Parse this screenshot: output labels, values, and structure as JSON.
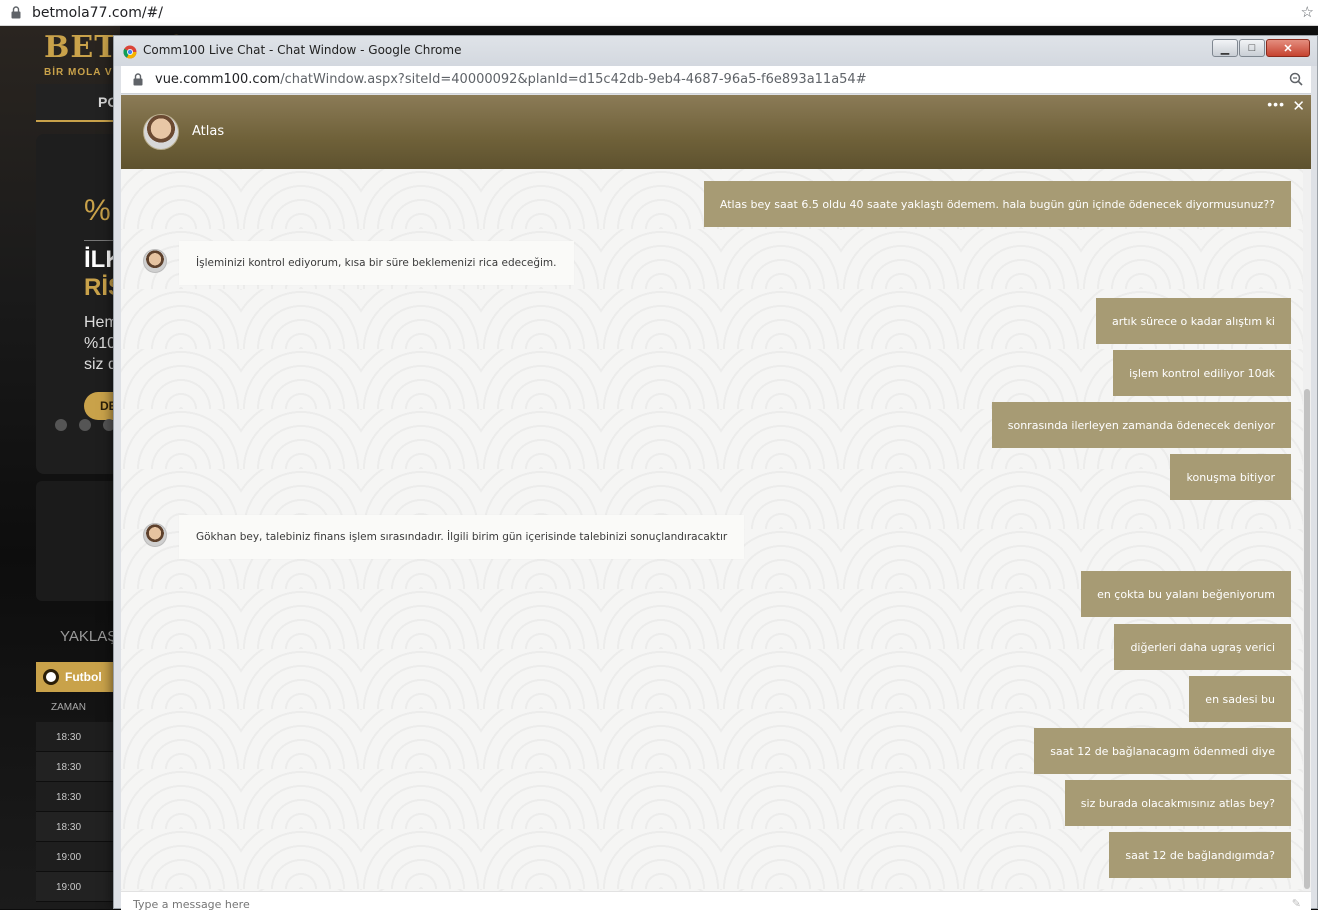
{
  "browser": {
    "url": "betmola77.com/#/"
  },
  "site": {
    "logo_text": "BET MOLA",
    "logo_sub": "BİR MOLA VE",
    "nav_item": "PO",
    "promo": {
      "percent": "%",
      "line1": "İLK",
      "line2": "RİS",
      "text1": "Hem",
      "text2": "%10",
      "text3": "siz d",
      "button": "DE"
    },
    "upcoming": "YAKLAŞ",
    "sport_tab": "Futbol",
    "time_header": "ZAMAN",
    "times": [
      "18:30",
      "18:30",
      "18:30",
      "18:30",
      "19:00",
      "19:00"
    ]
  },
  "popup": {
    "title": "Comm100 Live Chat - Chat Window - Google Chrome",
    "url_host": "vue.comm100.com",
    "url_path": "/chatWindow.aspx?siteId=40000092&planId=d15c42db-9eb4-4687-96a5-f6e893a11a54#",
    "btn_min": "▁",
    "btn_max": "□",
    "btn_close": "✕"
  },
  "chat": {
    "agent_name": "Atlas",
    "more_label": "•••",
    "close_label": "✕",
    "composer_placeholder": "Type a message here",
    "messages": [
      {
        "from": "visitor",
        "text": "Atlas bey saat 6.5 oldu 40 saate yaklaştı ödemem. hala bugün gün içinde ödenecek diyormusunuz??"
      },
      {
        "from": "agent",
        "text": "İşleminizi kontrol ediyorum, kısa bir süre beklemenizi rica edeceğim."
      },
      {
        "from": "visitor",
        "text": "artık sürece o kadar alıştım ki"
      },
      {
        "from": "visitor",
        "text": "işlem kontrol ediliyor 10dk"
      },
      {
        "from": "visitor",
        "text": "sonrasında ilerleyen zamanda ödenecek deniyor"
      },
      {
        "from": "visitor",
        "text": "konuşma bitiyor"
      },
      {
        "from": "agent",
        "text": "Gökhan bey, talebiniz finans işlem sırasındadır. İlgili birim gün içerisinde talebinizi sonuçlandıracaktır"
      },
      {
        "from": "visitor",
        "text": "en çokta bu yalanı beğeniyorum"
      },
      {
        "from": "visitor",
        "text": "diğerleri daha ugraş verici"
      },
      {
        "from": "visitor",
        "text": "en sadesi bu"
      },
      {
        "from": "visitor",
        "text": "saat 12 de bağlanacagım ödenmedi diye"
      },
      {
        "from": "visitor",
        "text": "siz burada olacakmısınız atlas bey?"
      },
      {
        "from": "visitor",
        "text": "saat 12 de bağlandıgımda?"
      }
    ]
  },
  "colors": {
    "header_bg": "#6f6139",
    "visitor_bubble": "#a79b74",
    "agent_bubble": "#fafaf8",
    "site_accent": "#c9a24a"
  }
}
